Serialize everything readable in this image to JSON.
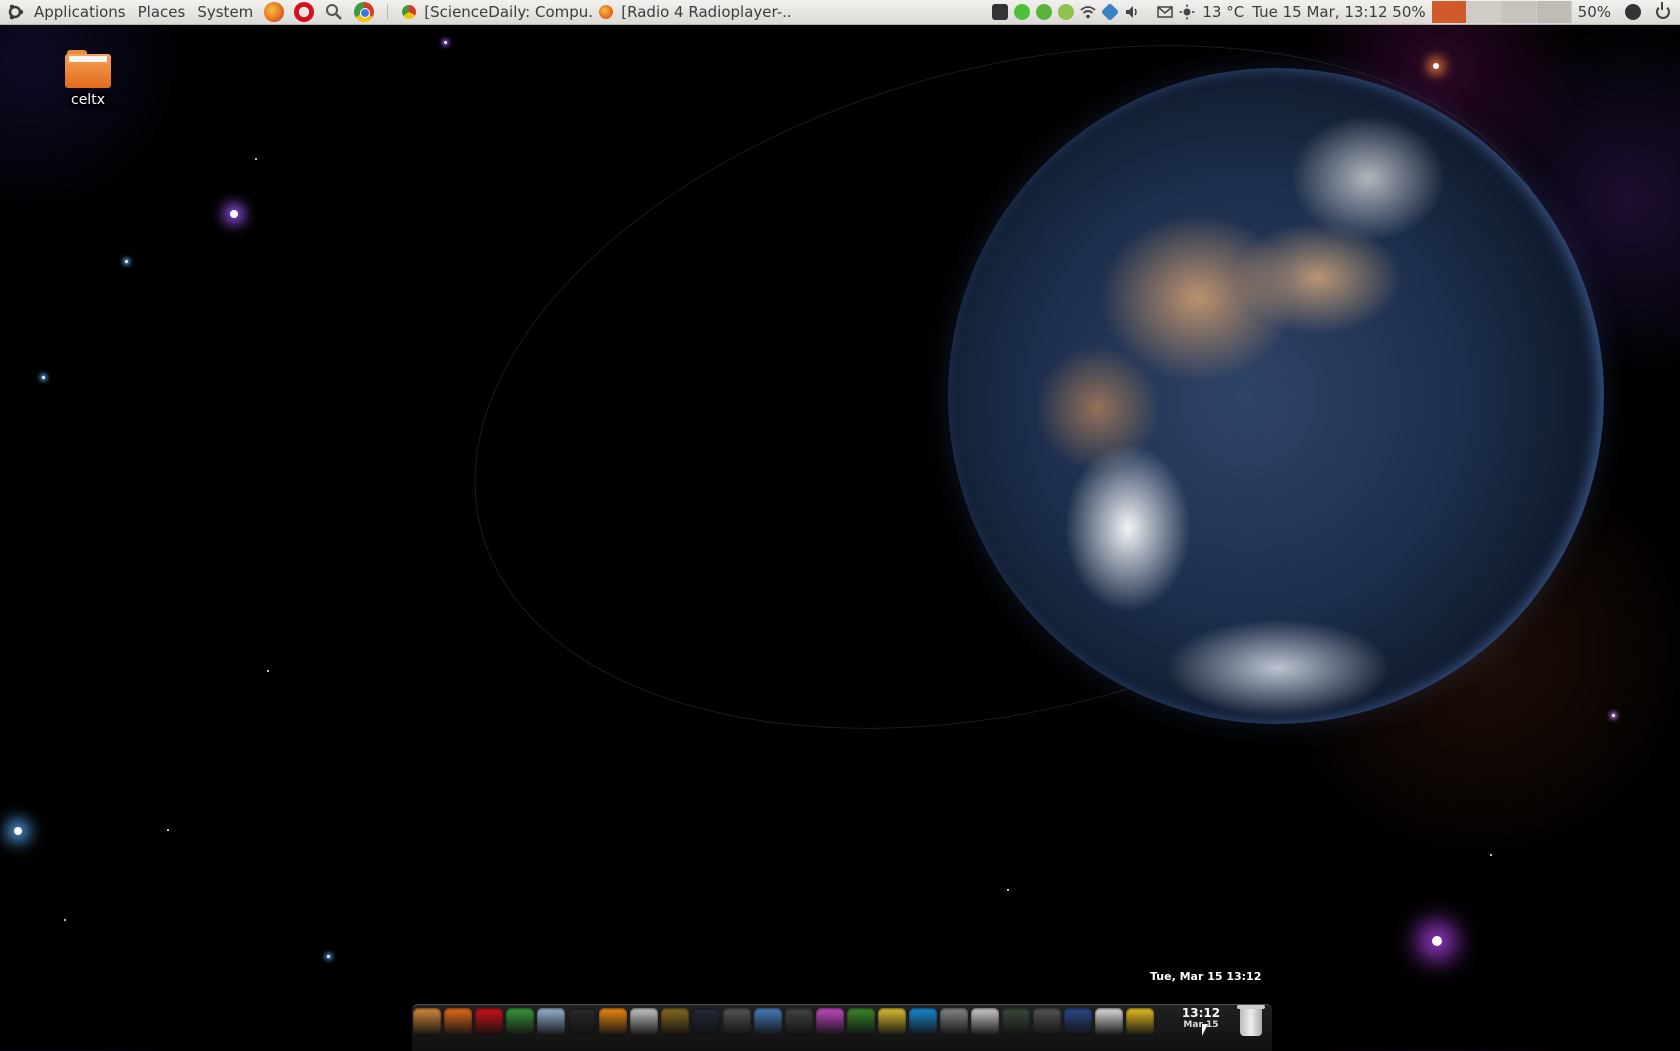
{
  "top_panel": {
    "menus": [
      "Applications",
      "Places",
      "System"
    ],
    "launchers": [
      {
        "name": "firefox-icon",
        "color": "#e66b1b"
      },
      {
        "name": "opera-icon",
        "color": "#d1121b"
      },
      {
        "name": "search-icon",
        "color": "#555555"
      },
      {
        "name": "chrome-icon",
        "color": "#3a9a3c"
      }
    ],
    "tasks": [
      {
        "title": "[ScienceDaily: Compu...",
        "icon": "chrome-icon",
        "color": "#e8b94a"
      },
      {
        "title": "[Radio 4 Radioplayer-...",
        "icon": "firefox-icon",
        "color": "#e66b1b"
      }
    ],
    "tray_icons": [
      {
        "name": "steam-icon",
        "color": "#333333"
      },
      {
        "name": "check-icon",
        "color": "#4fbf3a"
      },
      {
        "name": "status-green-icon",
        "color": "#5ab43c"
      },
      {
        "name": "chat-icon",
        "color": "#8fc24f"
      },
      {
        "name": "wifi-icon",
        "color": "#444444"
      },
      {
        "name": "dropbox-icon",
        "color": "#3b82c4"
      },
      {
        "name": "volume-icon",
        "color": "#444444"
      },
      {
        "name": "mail-icon",
        "color": "#444444"
      }
    ],
    "weather": "13 °C",
    "datetime": "Tue 15 Mar, 13:12 50%",
    "cpu_percent": "50%"
  },
  "desktop": {
    "icons": [
      {
        "label": "celtx"
      }
    ]
  },
  "dock": {
    "tooltip": "Tue, Mar 15 13:12",
    "clock_time": "13:12",
    "clock_date": "Mar 15",
    "items": [
      {
        "name": "anchor-icon",
        "color": "#d98a3a"
      },
      {
        "name": "firefox-icon",
        "color": "#e66b1b"
      },
      {
        "name": "opera-icon",
        "color": "#d1121b"
      },
      {
        "name": "chrome-icon",
        "color": "#3a9a3c"
      },
      {
        "name": "pidgin-icon",
        "color": "#9ab6d6"
      },
      {
        "name": "terminal-icon",
        "color": "#2a2a2a"
      },
      {
        "name": "vlc-icon",
        "color": "#f08a10"
      },
      {
        "name": "media-player-icon",
        "color": "#c9c9c9"
      },
      {
        "name": "warcraft-icon",
        "color": "#8a6a20"
      },
      {
        "name": "portal-icon",
        "color": "#222a3a"
      },
      {
        "name": "eject-icon",
        "color": "#555555"
      },
      {
        "name": "thunderbird-icon",
        "color": "#4a7fc0"
      },
      {
        "name": "mask-icon",
        "color": "#444444"
      },
      {
        "name": "picasa-icon",
        "color": "#c44ac4"
      },
      {
        "name": "tux-icon",
        "color": "#3a8a2a"
      },
      {
        "name": "folder-icon",
        "color": "#e0c030"
      },
      {
        "name": "skype-icon",
        "color": "#1a8ad4"
      },
      {
        "name": "calculator-icon",
        "color": "#888888"
      },
      {
        "name": "documents-icon",
        "color": "#cfcfcf"
      },
      {
        "name": "terminal-screen-icon",
        "color": "#3a4a3a"
      },
      {
        "name": "steam-icon",
        "color": "#555555"
      },
      {
        "name": "photoshop-icon",
        "color": "#2a4a8a"
      },
      {
        "name": "text-editor-icon",
        "color": "#e0e0e0"
      },
      {
        "name": "nautilus-icon",
        "color": "#e8c020"
      }
    ]
  }
}
